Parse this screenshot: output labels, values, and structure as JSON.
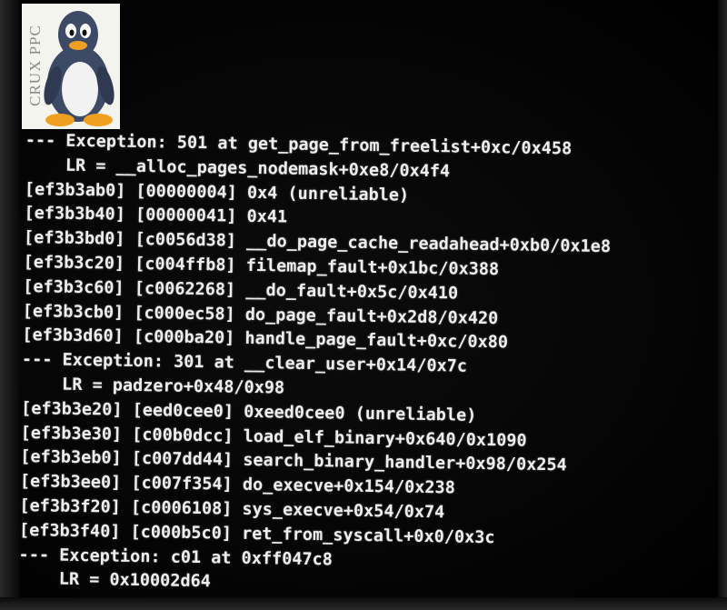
{
  "logo": {
    "text": "CRUX PPC",
    "icon": "tux-penguin-icon"
  },
  "console": {
    "lines": [
      "--- Exception: 501 at get_page_from_freelist+0xc/0x458",
      "    LR = __alloc_pages_nodemask+0xe8/0x4f4",
      "[ef3b3ab0] [00000004] 0x4 (unreliable)",
      "[ef3b3b40] [00000041] 0x41",
      "[ef3b3bd0] [c0056d38] __do_page_cache_readahead+0xb0/0x1e8",
      "[ef3b3c20] [c004ffb8] filemap_fault+0x1bc/0x388",
      "[ef3b3c60] [c0062268] __do_fault+0x5c/0x410",
      "[ef3b3cb0] [c000ec58] do_page_fault+0x2d8/0x420",
      "[ef3b3d60] [c000ba20] handle_page_fault+0xc/0x80",
      "--- Exception: 301 at __clear_user+0x14/0x7c",
      "    LR = padzero+0x48/0x98",
      "[ef3b3e20] [eed0cee0] 0xeed0cee0 (unreliable)",
      "[ef3b3e30] [c00b0dcc] load_elf_binary+0x640/0x1090",
      "[ef3b3eb0] [c007dd44] search_binary_handler+0x98/0x254",
      "[ef3b3ee0] [c007f354] do_execve+0x154/0x238",
      "[ef3b3f20] [c0006108] sys_execve+0x54/0x74",
      "[ef3b3f40] [c000b5c0] ret_from_syscall+0x0/0x3c",
      "--- Exception: c01 at 0xff047c8",
      "    LR = 0x10002d64"
    ]
  }
}
